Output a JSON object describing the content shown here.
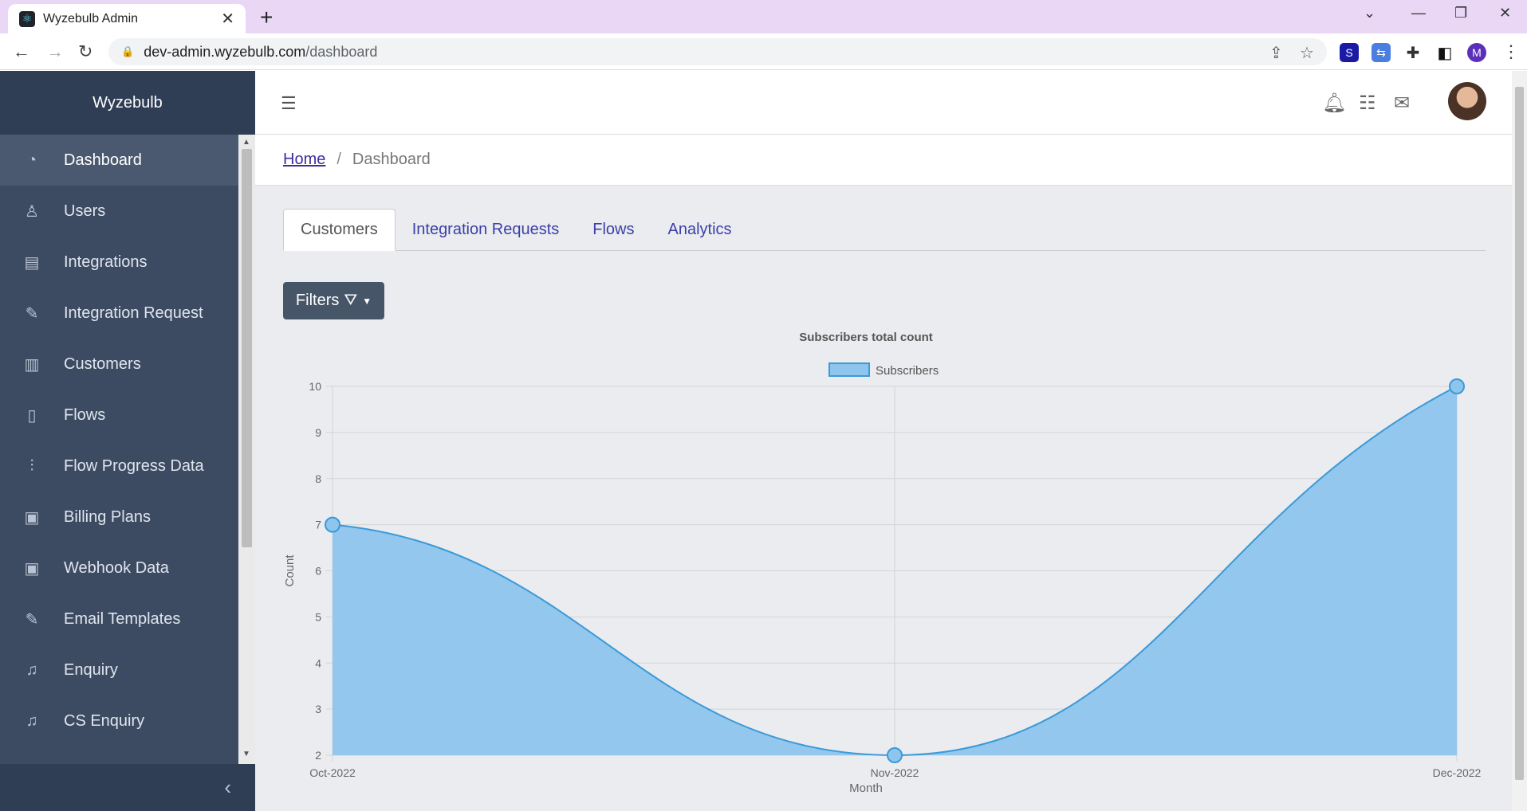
{
  "browser": {
    "tab_title": "Wyzebulb Admin",
    "url_host": "dev-admin.wyzebulb.com",
    "url_path": "/dashboard",
    "profile_initial": "M"
  },
  "sidebar": {
    "brand": "Wyzebulb",
    "items": [
      {
        "label": "Dashboard",
        "icon": "speedometer-icon",
        "active": true
      },
      {
        "label": "Users",
        "icon": "user-icon"
      },
      {
        "label": "Integrations",
        "icon": "list-icon"
      },
      {
        "label": "Integration Request",
        "icon": "pencil-icon"
      },
      {
        "label": "Customers",
        "icon": "book-icon"
      },
      {
        "label": "Flows",
        "icon": "flow-icon"
      },
      {
        "label": "Flow Progress Data",
        "icon": "sliders-icon"
      },
      {
        "label": "Billing Plans",
        "icon": "money-icon"
      },
      {
        "label": "Webhook Data",
        "icon": "money-icon"
      },
      {
        "label": "Email Templates",
        "icon": "pencil-icon"
      },
      {
        "label": "Enquiry",
        "icon": "bell-icon"
      },
      {
        "label": "CS Enquiry",
        "icon": "bell-icon"
      }
    ]
  },
  "breadcrumb": {
    "home": "Home",
    "separator": "/",
    "current": "Dashboard"
  },
  "tabs": [
    "Customers",
    "Integration Requests",
    "Flows",
    "Analytics"
  ],
  "filters_label": "Filters",
  "colors": {
    "sidebar": "#3d4b62",
    "accent": "#3b3fa8",
    "series_fill": "#8ec5ec",
    "series_line": "#3a9ad9"
  },
  "chart_data": {
    "type": "area",
    "title": "Subscribers total count",
    "xlabel": "Month",
    "ylabel": "Count",
    "categories": [
      "Oct-2022",
      "Nov-2022",
      "Dec-2022"
    ],
    "series": [
      {
        "name": "Subscribers",
        "values": [
          7,
          2,
          10
        ]
      }
    ],
    "ylim": [
      2,
      10
    ],
    "yticks": [
      2,
      3,
      4,
      5,
      6,
      7,
      8,
      9,
      10
    ],
    "grid": true,
    "legend": "top-center"
  }
}
